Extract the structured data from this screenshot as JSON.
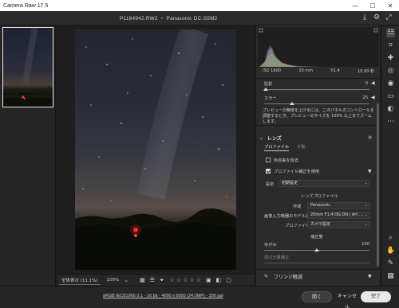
{
  "window": {
    "title": "Camera Raw 17.5",
    "min": "—",
    "max": "☐",
    "close": "✕"
  },
  "header": {
    "filename": "P1164942.RW2 ・ Panasonic DC-S5M2"
  },
  "histogram": {
    "iso": "ISO 1600",
    "focal": "20 mm",
    "aperture": "f/1.4",
    "shutter": "10.00 秒"
  },
  "panel": {
    "row_shade": {
      "label": "陰影",
      "value": "0"
    },
    "row_color": {
      "label": "カラー",
      "value": "25"
    },
    "note": "プレビューの精度を上げるには、このパネルのコントロールを調整するとき、プレビューのサイズを 100% 以上までズームします。",
    "lens_section": "レンズ",
    "tabs": {
      "profile": "プロファイル",
      "manual": "手動"
    },
    "chk_remove_ca": "色収差を除去",
    "chk_use_profile": "プロファイル補正を使用",
    "setup_label": "設定",
    "setup_value": "初期設定",
    "lens_profile_title": "レンズプロファイル",
    "make_label": "作成",
    "make_value": "Panasonic",
    "model_label": "画像入力機器のモデル名",
    "model_value": "20mm F1.4 DG DN | Art ...",
    "profile_label": "プロファイル",
    "profile_value": "カメラ設定",
    "correction_title": "補正量",
    "distortion_label": "ゆがみ",
    "distortion_value": "100",
    "vignette_label": "周辺光量補正",
    "fringe_section": "フリンジ軽減"
  },
  "viewbar": {
    "fit": "全体表示 (11.1%)",
    "zoom": "100%",
    "stars": [
      "☆",
      "☆",
      "☆",
      "☆",
      "☆"
    ]
  },
  "status": {
    "workflow": "sRGB IEC61966-2.1 - 16 bit - 4000 x 6000 (24.0MP) - 300 ppi",
    "open": "開く",
    "cancel": "キャンセル",
    "done": "完了"
  }
}
